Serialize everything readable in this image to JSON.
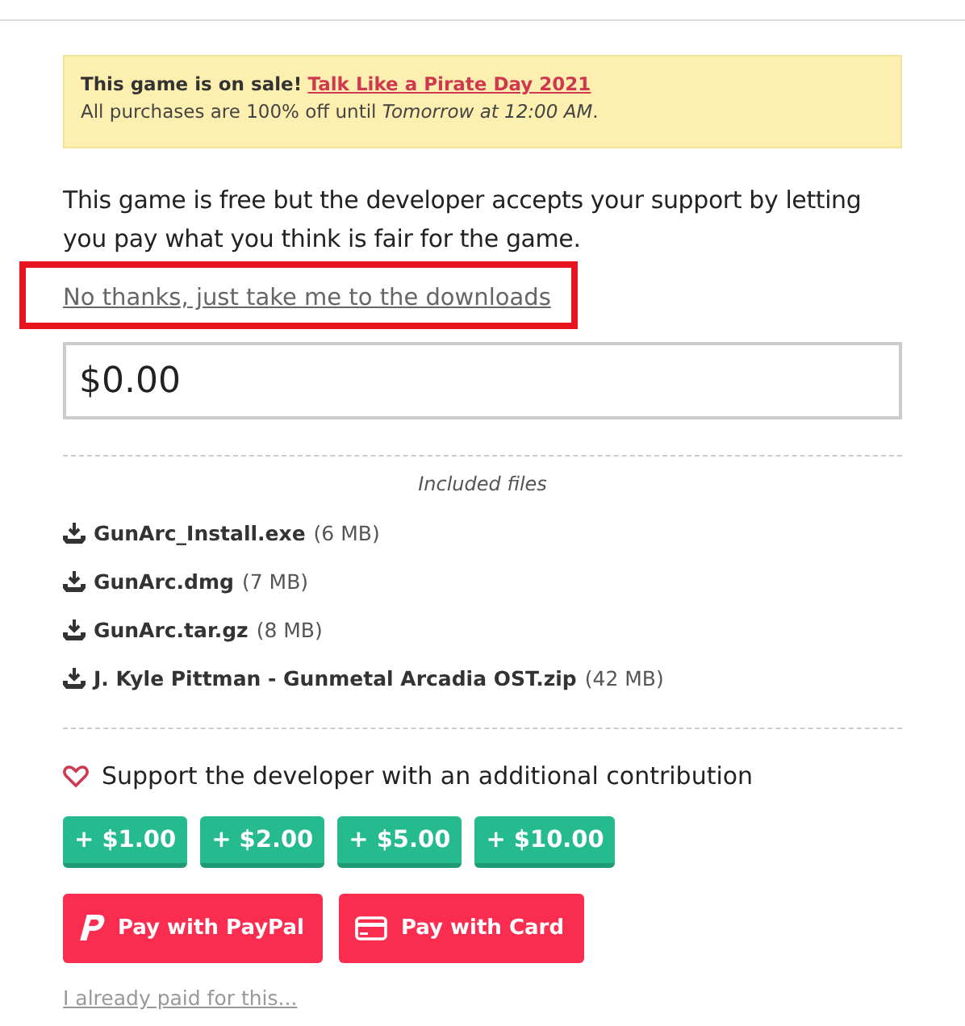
{
  "sale_banner": {
    "lead": "This game is on sale!",
    "event_link": "Talk Like a Pirate Day 2021",
    "details": "All purchases are 100% off until *Tomorrow at 12:00 AM*."
  },
  "description": "This game is free but the developer accepts your support by letting you pay what you think is fair for the game.",
  "skip_link": {
    "label": "No thanks, just take me to the downloads",
    "highlighted": true
  },
  "price_field": {
    "value": "$0.00"
  },
  "included_files": {
    "heading": "Included files",
    "files": [
      {
        "name": "GunArc_Install.exe",
        "size": "(6 MB)"
      },
      {
        "name": "GunArc.dmg",
        "size": "(7 MB)"
      },
      {
        "name": "GunArc.tar.gz",
        "size": "(8 MB)"
      },
      {
        "name": "J. Kyle Pittman - Gunmetal Arcadia OST.zip",
        "size": "(42 MB)"
      }
    ]
  },
  "support": {
    "label": "Support the developer with an additional contribution",
    "amounts": [
      "+ $1.00",
      "+ $2.00",
      "+ $5.00",
      "+ $10.00"
    ]
  },
  "payment_buttons": [
    {
      "kind": "paypal",
      "label": "Pay with PayPal"
    },
    {
      "kind": "card",
      "label": "Pay with Card"
    }
  ],
  "already_paid_link": "I already paid for this..."
}
